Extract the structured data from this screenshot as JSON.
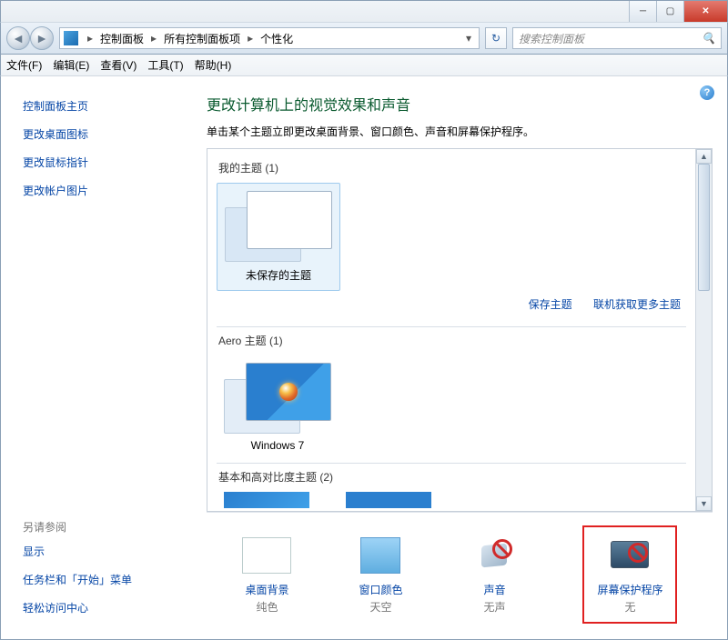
{
  "window": {
    "minimize": "─",
    "maximize": "▢",
    "close": "✕"
  },
  "breadcrumb": {
    "level1": "控制面板",
    "level2": "所有控制面板项",
    "level3": "个性化"
  },
  "search": {
    "placeholder": "搜索控制面板"
  },
  "menu": {
    "file": "文件(F)",
    "edit": "编辑(E)",
    "view": "查看(V)",
    "tools": "工具(T)",
    "help": "帮助(H)"
  },
  "sidebar": {
    "home": "控制面板主页",
    "desktop_icons": "更改桌面图标",
    "mouse_pointers": "更改鼠标指针",
    "account_picture": "更改帐户图片",
    "see_also": "另请参阅",
    "display": "显示",
    "taskbar": "任务栏和「开始」菜单",
    "ease": "轻松访问中心"
  },
  "main": {
    "heading": "更改计算机上的视觉效果和声音",
    "subtitle": "单击某个主题立即更改桌面背景、窗口颜色、声音和屏幕保护程序。",
    "sections": {
      "my_themes": "我的主题 (1)",
      "unsaved_theme": "未保存的主题",
      "save_theme": "保存主题",
      "get_online": "联机获取更多主题",
      "aero_themes": "Aero 主题 (1)",
      "win7": "Windows 7",
      "basic_themes": "基本和高对比度主题 (2)"
    }
  },
  "bottom": {
    "desktop_bg": {
      "label": "桌面背景",
      "value": "纯色"
    },
    "window_color": {
      "label": "窗口颜色",
      "value": "天空"
    },
    "sound": {
      "label": "声音",
      "value": "无声"
    },
    "screensaver": {
      "label": "屏幕保护程序",
      "value": "无"
    }
  }
}
